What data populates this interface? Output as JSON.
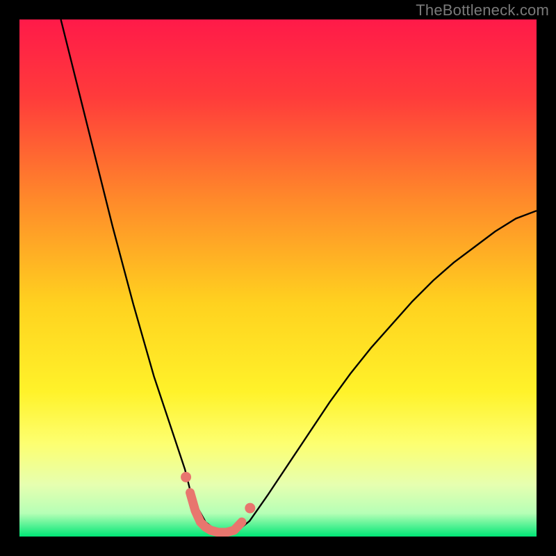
{
  "watermark": "TheBottleneck.com",
  "chart_data": {
    "type": "line",
    "title": "",
    "xlabel": "",
    "ylabel": "",
    "xlim": [
      0,
      100
    ],
    "ylim": [
      0,
      100
    ],
    "background_gradient": {
      "stops": [
        {
          "offset": 0.0,
          "color": "#ff1a49"
        },
        {
          "offset": 0.15,
          "color": "#ff3b3b"
        },
        {
          "offset": 0.35,
          "color": "#ff8a2a"
        },
        {
          "offset": 0.55,
          "color": "#ffd21f"
        },
        {
          "offset": 0.72,
          "color": "#fff22a"
        },
        {
          "offset": 0.82,
          "color": "#fdff70"
        },
        {
          "offset": 0.9,
          "color": "#e6ffb0"
        },
        {
          "offset": 0.955,
          "color": "#b6ffb6"
        },
        {
          "offset": 1.0,
          "color": "#00e676"
        }
      ]
    },
    "series": [
      {
        "name": "bottleneck-curve",
        "color": "#000000",
        "width": 2.4,
        "x": [
          8,
          10,
          12,
          14,
          16,
          18,
          20,
          22,
          24,
          26,
          28,
          30,
          32,
          33,
          34.5,
          36,
          38,
          40,
          42,
          44.5,
          48,
          52,
          56,
          60,
          64,
          68,
          72,
          76,
          80,
          84,
          88,
          92,
          96,
          100
        ],
        "y": [
          100,
          92,
          84,
          76,
          68,
          60,
          52.5,
          45,
          38,
          31,
          25,
          19,
          13,
          9,
          5.5,
          2.8,
          1.2,
          0.5,
          1.0,
          3.0,
          8,
          14,
          20,
          26,
          31.5,
          36.5,
          41,
          45.5,
          49.5,
          53,
          56,
          59,
          61.5,
          63
        ]
      },
      {
        "name": "marker-band",
        "color": "#e8766e",
        "width": 13,
        "linecap": "round",
        "x": [
          33.0,
          34.0,
          35.0,
          36.0,
          37.0,
          38.5,
          40.0,
          41.5,
          43.0
        ],
        "y": [
          8.5,
          5.0,
          2.8,
          1.8,
          1.2,
          0.8,
          0.8,
          1.2,
          2.8
        ]
      }
    ],
    "marker_dots": {
      "color": "#e8766e",
      "radius": 7.5,
      "points": [
        {
          "x": 32.2,
          "y": 11.5
        },
        {
          "x": 44.6,
          "y": 5.5
        }
      ]
    }
  }
}
